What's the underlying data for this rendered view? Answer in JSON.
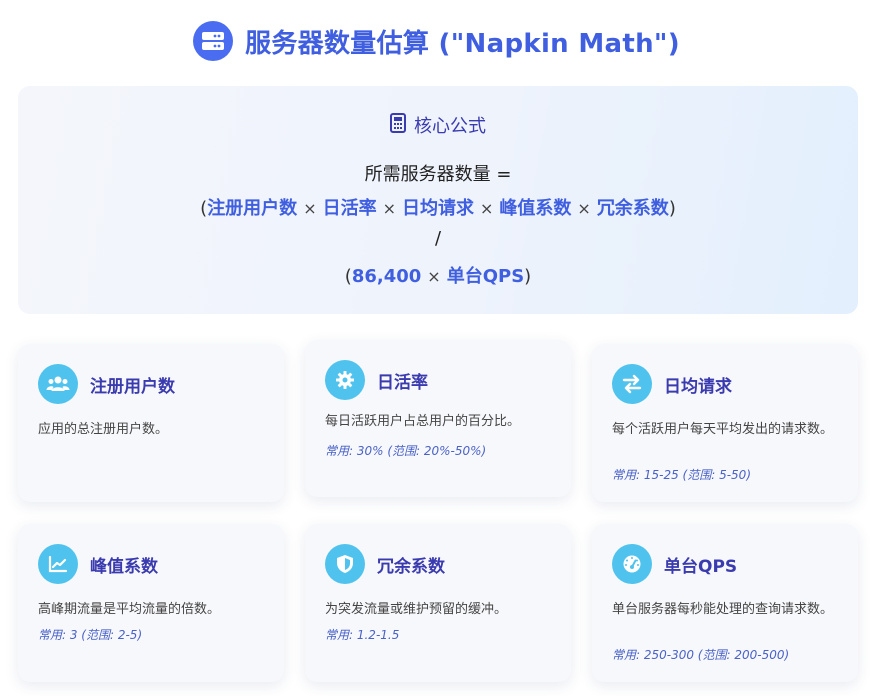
{
  "header": {
    "title": "服务器数量估算 (\"Napkin Math\")",
    "icon": "server-icon"
  },
  "formula": {
    "heading": "核心公式",
    "heading_icon": "calculator-icon",
    "line1": "所需服务器数量 =",
    "numerator_terms": [
      "注册用户数",
      "日活率",
      "日均请求",
      "峰值系数",
      "冗余系数"
    ],
    "operator_times": "×",
    "open_paren": "(",
    "close_paren": ")",
    "divider": "/",
    "denominator_constant": "86,400",
    "denominator_term": "单台QPS"
  },
  "cards": [
    {
      "title": "注册用户数",
      "icon": "users-icon",
      "description": "应用的总注册用户数。",
      "common": ""
    },
    {
      "title": "日活率",
      "icon": "gear-icon",
      "description": "每日活跃用户占总用户的百分比。",
      "common": "常用: 30% (范围: 20%-50%)"
    },
    {
      "title": "日均请求",
      "icon": "exchange-icon",
      "description": "每个活跃用户每天平均发出的请求数。",
      "common": "常用: 15-25 (范围: 5-50)"
    },
    {
      "title": "峰值系数",
      "icon": "line-chart-icon",
      "description": "高峰期流量是平均流量的倍数。",
      "common": "常用: 3 (范围: 2-5)"
    },
    {
      "title": "冗余系数",
      "icon": "shield-icon",
      "description": "为突发流量或维护预留的缓冲。",
      "common": "常用: 1.2-1.5"
    },
    {
      "title": "单台QPS",
      "icon": "speedometer-icon",
      "description": "单台服务器每秒能处理的查询请求数。",
      "common": "常用: 250-300 (范围: 200-500)"
    }
  ],
  "colors": {
    "accent": "#3f5fe0",
    "title": "#3b3bb0",
    "icon_bg": "#4fc3ee"
  }
}
